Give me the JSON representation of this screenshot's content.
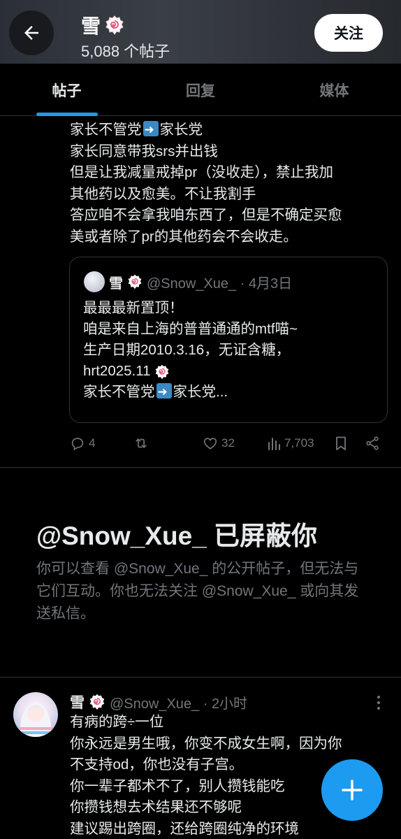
{
  "header": {
    "name": "雪",
    "post_count": "5,088 个帖子",
    "follow_label": "关注"
  },
  "tabs": [
    {
      "label": "帖子",
      "active": true
    },
    {
      "label": "回复",
      "active": false
    },
    {
      "label": "媒体",
      "active": false
    }
  ],
  "post1": {
    "lines": [
      {
        "before": "家长不管党",
        "after": "家长党",
        "arrow": true
      },
      {
        "text": "家长同意带我srs并出钱"
      },
      {
        "text": "但是让我减量戒掉pr（没收走），禁止我加"
      },
      {
        "text": "其他药以及愈美。不让我割手"
      },
      {
        "text": "答应咱不会拿我咱东西了，但是不确定买愈"
      },
      {
        "text": "美或者除了pr的其他药会不会收走。"
      }
    ],
    "quote": {
      "name": "雪",
      "meta": "@Snow_Xue_ · 4月3日",
      "lines": [
        "最最最新置顶！",
        "咱是来自上海的普普通通的mtf喵~",
        "生产日期2010.3.16，无证含糖，",
        "hrt2025.11"
      ],
      "last_before": "家长不管党",
      "last_after": "家长党..."
    },
    "actions": {
      "replies": "4",
      "likes": "32",
      "views": "7,703"
    }
  },
  "blocked": {
    "title": "@Snow_Xue_ 已屏蔽你",
    "description": "你可以查看 @Snow_Xue_ 的公开帖子，但无法与它们互动。你也无法关注 @Snow_Xue_ 或向其发送私信。"
  },
  "post2": {
    "name": "雪",
    "meta": "@Snow_Xue_ · 2小时",
    "lines": [
      "有病的跨÷一位",
      "你永远是男生哦，你变不成女生啊，因为你",
      "不支持od，你也没有子宫。",
      "你一辈子都术不了，别人攒钱能吃",
      "你攒钱想去术结果还不够呢",
      "建议踢出跨圈，还给跨圈纯净的环境"
    ]
  },
  "colors": {
    "accent": "#1d9bf0",
    "muted": "#71767b",
    "border": "#2f3336"
  }
}
